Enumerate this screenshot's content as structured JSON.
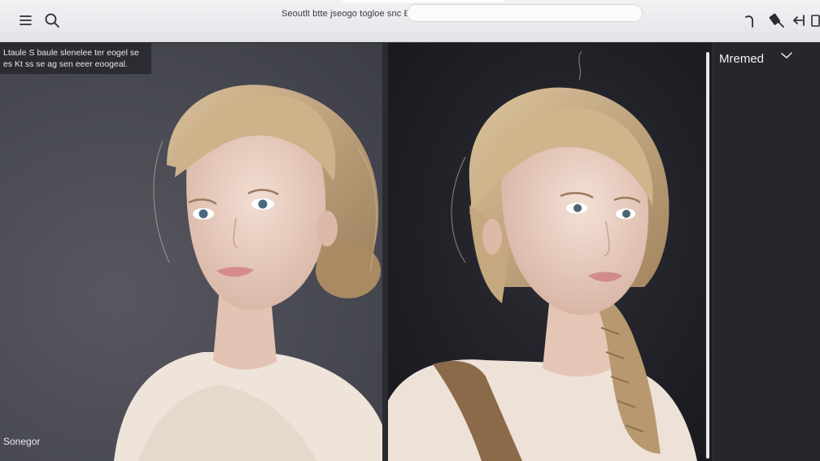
{
  "topbar": {
    "search_hint": "Seoutlt btte jseogo togloe snc Eit Btte mogoe",
    "search_placeholder": "",
    "icons": [
      "menu-icon",
      "search-icon",
      "undo-icon",
      "eraser-icon",
      "back-arrow-icon",
      "panel-icon"
    ]
  },
  "left_panel": {
    "info_line1": "Ltaule S baule slenelee ter eogel se",
    "info_line2": "es Kt ss se ag sen eeer eoogeal.",
    "caption": "Sonegor"
  },
  "right_panel": {
    "title": "Mremed"
  },
  "colors": {
    "topbar_bg": "#e8e9eb",
    "left_bg": "#4b4c55",
    "mid_bg": "#1f2026",
    "right_bg": "#26272b",
    "hair": "#c4a77c",
    "skin": "#ecd3c7"
  }
}
